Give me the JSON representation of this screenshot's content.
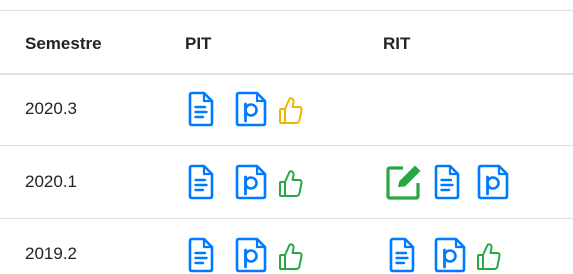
{
  "headers": [
    "Semestre",
    "PIT",
    "RIT"
  ],
  "rows": [
    {
      "semester": "2020.3",
      "pit_icons": [
        "document-icon",
        "p-document-icon",
        "thumbs-up-icon"
      ],
      "pit_thumb_color": "#f0b400",
      "rit_icons": []
    },
    {
      "semester": "2020.1",
      "pit_icons": [
        "document-icon",
        "p-document-icon",
        "thumbs-up-icon"
      ],
      "pit_thumb_color": "#28a745",
      "rit_icons": [
        "edit-icon",
        "document-icon",
        "p-document-icon"
      ]
    },
    {
      "semester": "2019.2",
      "pit_icons": [
        "document-icon",
        "p-document-icon",
        "thumbs-up-icon"
      ],
      "pit_thumb_color": "#28a745",
      "rit_icons": [
        "document-icon",
        "p-document-icon",
        "thumbs-up-icon"
      ],
      "rit_thumb_color": "#28a745"
    }
  ],
  "colors": {
    "primary": "#007bff",
    "success": "#28a745",
    "warning": "#f0b400",
    "border": "#dee2e6",
    "text": "#212529"
  }
}
